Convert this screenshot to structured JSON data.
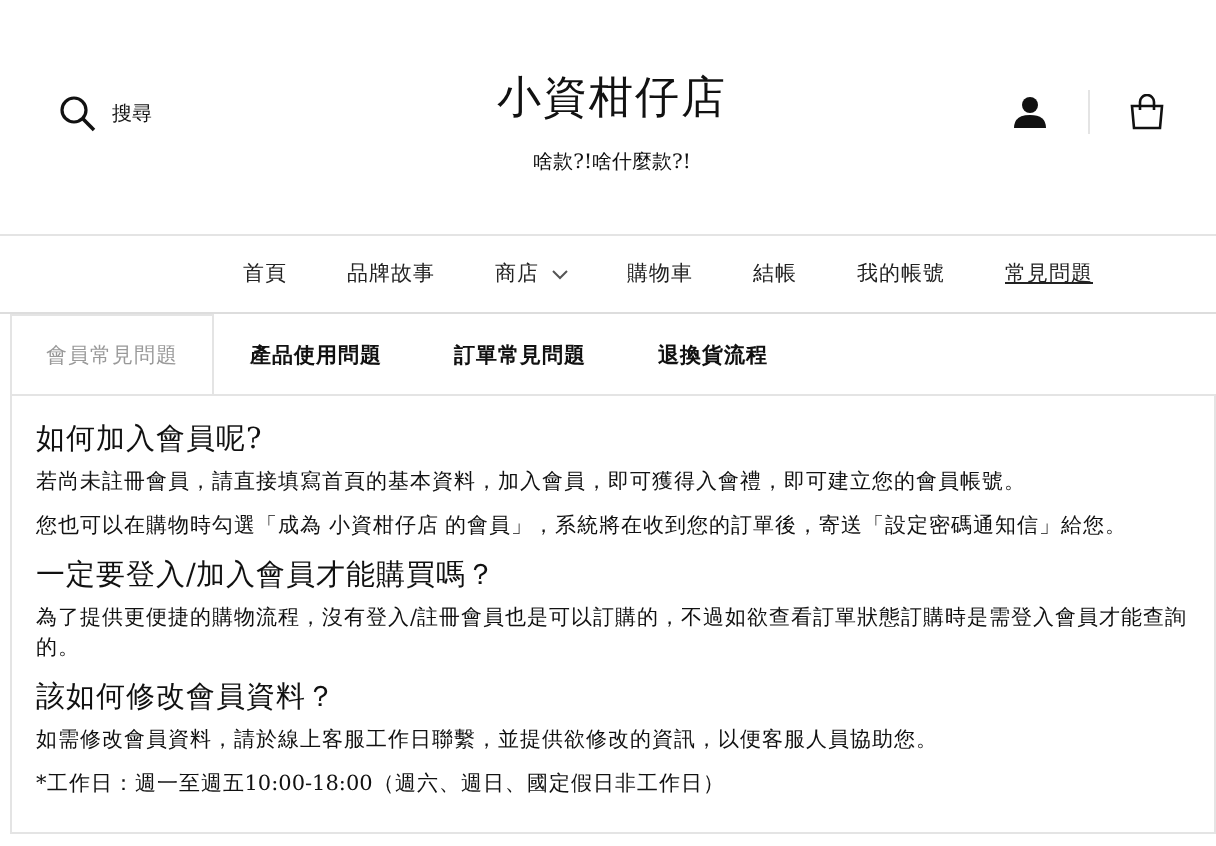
{
  "header": {
    "search_label": "搜尋",
    "store_name": "小資柑仔店",
    "tagline": "啥款?!啥什麼款?!"
  },
  "nav": [
    {
      "label": "首頁",
      "selected": false,
      "dropdown": false
    },
    {
      "label": "品牌故事",
      "selected": false,
      "dropdown": false
    },
    {
      "label": "商店",
      "selected": false,
      "dropdown": true
    },
    {
      "label": "購物車",
      "selected": false,
      "dropdown": false
    },
    {
      "label": "結帳",
      "selected": false,
      "dropdown": false
    },
    {
      "label": "我的帳號",
      "selected": false,
      "dropdown": false
    },
    {
      "label": "常見問題",
      "selected": true,
      "dropdown": false
    }
  ],
  "tabs": [
    {
      "label": "會員常見問題",
      "selected": true
    },
    {
      "label": "產品使用問題",
      "selected": false
    },
    {
      "label": "訂單常見問題",
      "selected": false
    },
    {
      "label": "退換貨流程",
      "selected": false
    }
  ],
  "faq": [
    {
      "question": "如何加入會員呢?",
      "answers": [
        "若尚未註冊會員，請直接填寫首頁的基本資料，加入會員，即可獲得入會禮，即可建立您的會員帳號。",
        "您也可以在購物時勾選「成為 小資柑仔店 的會員」，系統將在收到您的訂單後，寄送「設定密碼通知信」給您。"
      ]
    },
    {
      "question": "一定要登入/加入會員才能購買嗎？",
      "answers": [
        "為了提供更便捷的購物流程，沒有登入/註冊會員也是可以訂購的，不過如欲查看訂單狀態訂購時是需登入會員才能查詢的。"
      ]
    },
    {
      "question": "該如何修改會員資料？",
      "answers": [
        "如需修改會員資料，請於線上客服工作日聯繫，並提供欲修改的資訊，以便客服人員協助您。",
        "*工作日：週一至週五10:00-18:00（週六、週日、國定假日非工作日）"
      ]
    }
  ]
}
